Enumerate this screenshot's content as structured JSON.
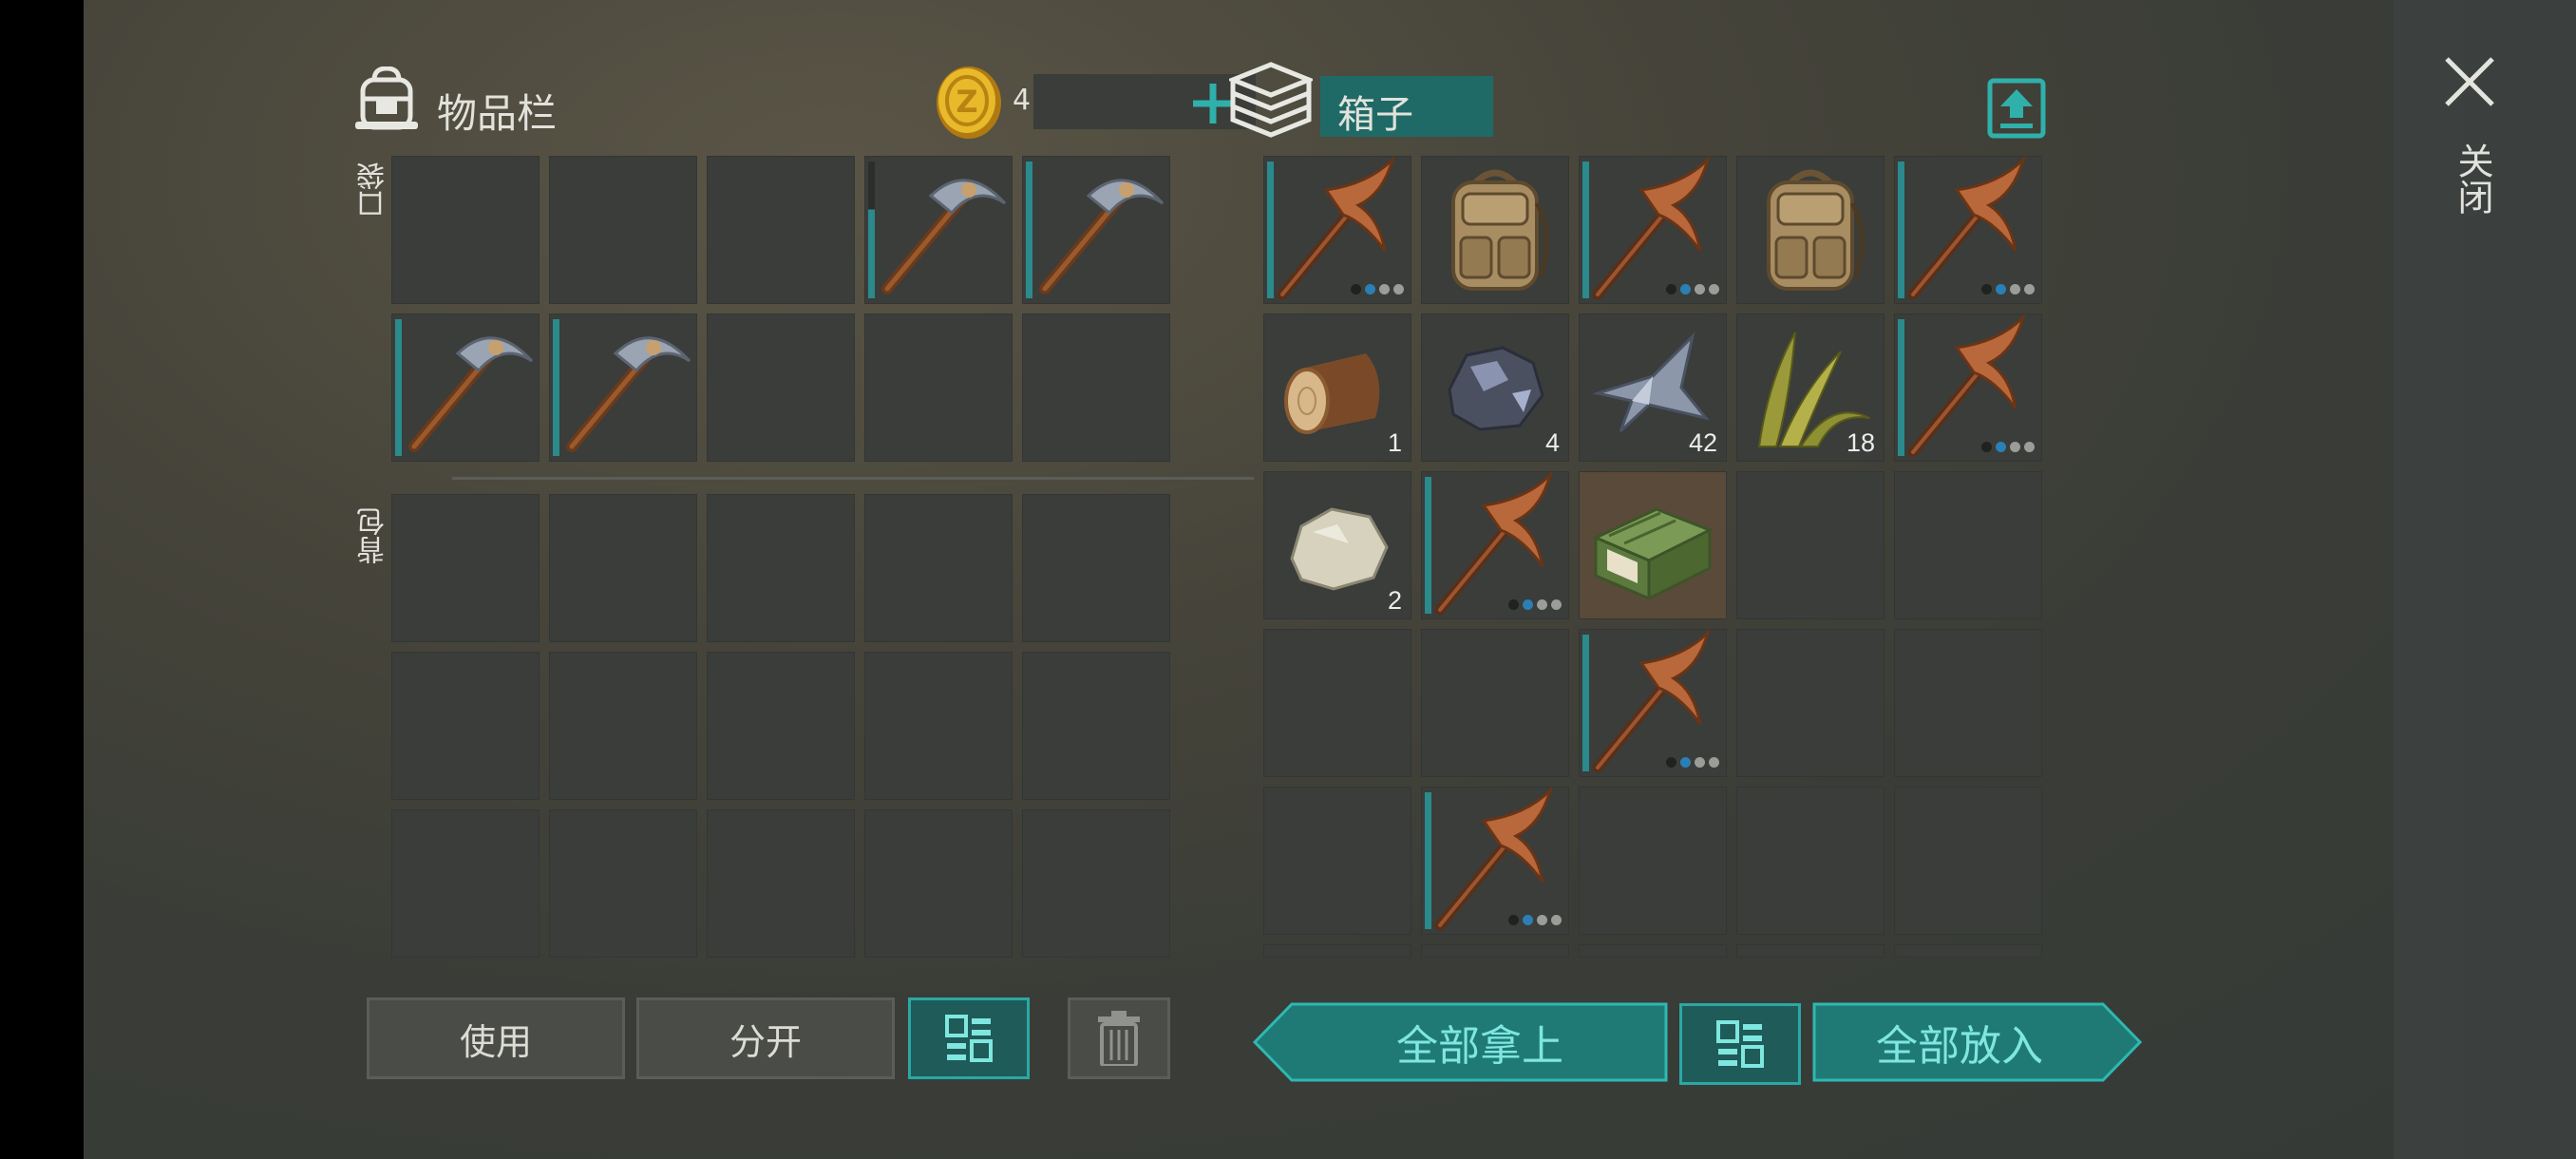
{
  "inventory": {
    "title": "物品栏",
    "coins": "4",
    "pocket_label": "口袋",
    "backpack_label": "背包",
    "pocket_slots": [
      {
        "item": ""
      },
      {
        "item": ""
      },
      {
        "item": ""
      },
      {
        "item": "pickaxe-icon",
        "durability": "partial"
      },
      {
        "item": "pickaxe-icon",
        "durability": "full"
      },
      {
        "item": "pickaxe-icon",
        "durability": "full"
      },
      {
        "item": "pickaxe-icon",
        "durability": "full"
      },
      {
        "item": ""
      },
      {
        "item": ""
      },
      {
        "item": ""
      }
    ],
    "backpack_slots": 15,
    "buttons": {
      "use": "使用",
      "split": "分开"
    }
  },
  "chest": {
    "title": "箱子",
    "slots": [
      {
        "item": "copper-pickaxe-icon",
        "dots": "dbgg"
      },
      {
        "item": "backpack-icon"
      },
      {
        "item": "copper-pickaxe-icon",
        "dots": "dbgg"
      },
      {
        "item": "backpack-icon"
      },
      {
        "item": "copper-pickaxe-icon",
        "dots": "dbgg"
      },
      {
        "item": "wood-log-icon",
        "qty": "1"
      },
      {
        "item": "iron-ore-icon",
        "qty": "4"
      },
      {
        "item": "metal-scrap-icon",
        "qty": "42"
      },
      {
        "item": "plant-fiber-icon",
        "qty": "18"
      },
      {
        "item": "copper-pickaxe-icon",
        "dots": "dbgg"
      },
      {
        "item": "stone-icon",
        "qty": "2"
      },
      {
        "item": "copper-pickaxe-icon",
        "dots": "dbgg"
      },
      {
        "item": "green-crate-icon",
        "highlight": true
      },
      {
        "item": ""
      },
      {
        "item": ""
      },
      {
        "item": ""
      },
      {
        "item": ""
      },
      {
        "item": "copper-pickaxe-icon",
        "dots": "dbgg"
      },
      {
        "item": ""
      },
      {
        "item": ""
      },
      {
        "item": ""
      },
      {
        "item": "copper-pickaxe-icon",
        "dots": "dbgg"
      },
      {
        "item": ""
      },
      {
        "item": ""
      },
      {
        "item": ""
      }
    ],
    "buttons": {
      "take_all": "全部拿上",
      "put_all": "全部放入"
    }
  },
  "close_label": "关闭",
  "colors": {
    "accent": "#2aa8a5",
    "panel_slot": "#3a3d3a",
    "durability_bar": "#2a8a8c"
  }
}
